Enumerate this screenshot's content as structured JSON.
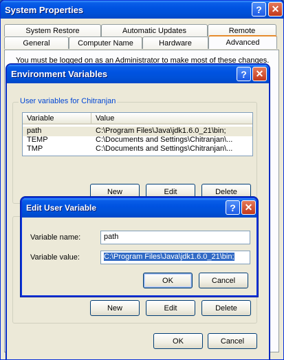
{
  "system_props": {
    "title": "System Properties",
    "tabs_back": [
      "System Restore",
      "Automatic Updates",
      "Remote"
    ],
    "tabs_front": [
      "General",
      "Computer Name",
      "Hardware",
      "Advanced"
    ],
    "notice": "You must be logged on as an Administrator to make most of these changes."
  },
  "env_vars": {
    "title": "Environment Variables",
    "user_group": "User variables for Chitranjan",
    "columns": [
      "Variable",
      "Value"
    ],
    "rows": [
      {
        "variable": "path",
        "value": "C:\\Program Files\\Java\\jdk1.6.0_21\\bin;"
      },
      {
        "variable": "TEMP",
        "value": "C:\\Documents and Settings\\Chitranjan\\..."
      },
      {
        "variable": "TMP",
        "value": "C:\\Documents and Settings\\Chitranjan\\..."
      }
    ],
    "new": "New",
    "edit": "Edit",
    "delete": "Delete",
    "ok": "OK",
    "cancel": "Cancel"
  },
  "edit_dialog": {
    "title": "Edit User Variable",
    "name_label": "Variable name:",
    "name_value": "path",
    "value_label": "Variable value:",
    "value_value": "C:\\Program Files\\Java\\jdk1.6.0_21\\bin;",
    "ok": "OK",
    "cancel": "Cancel"
  },
  "icons": {
    "help": "?",
    "close": "✕"
  },
  "colors": {
    "title_bar": "#0054e3",
    "selection": "#316ac5",
    "window": "#ece9d8",
    "group_text": "#0046d5"
  }
}
